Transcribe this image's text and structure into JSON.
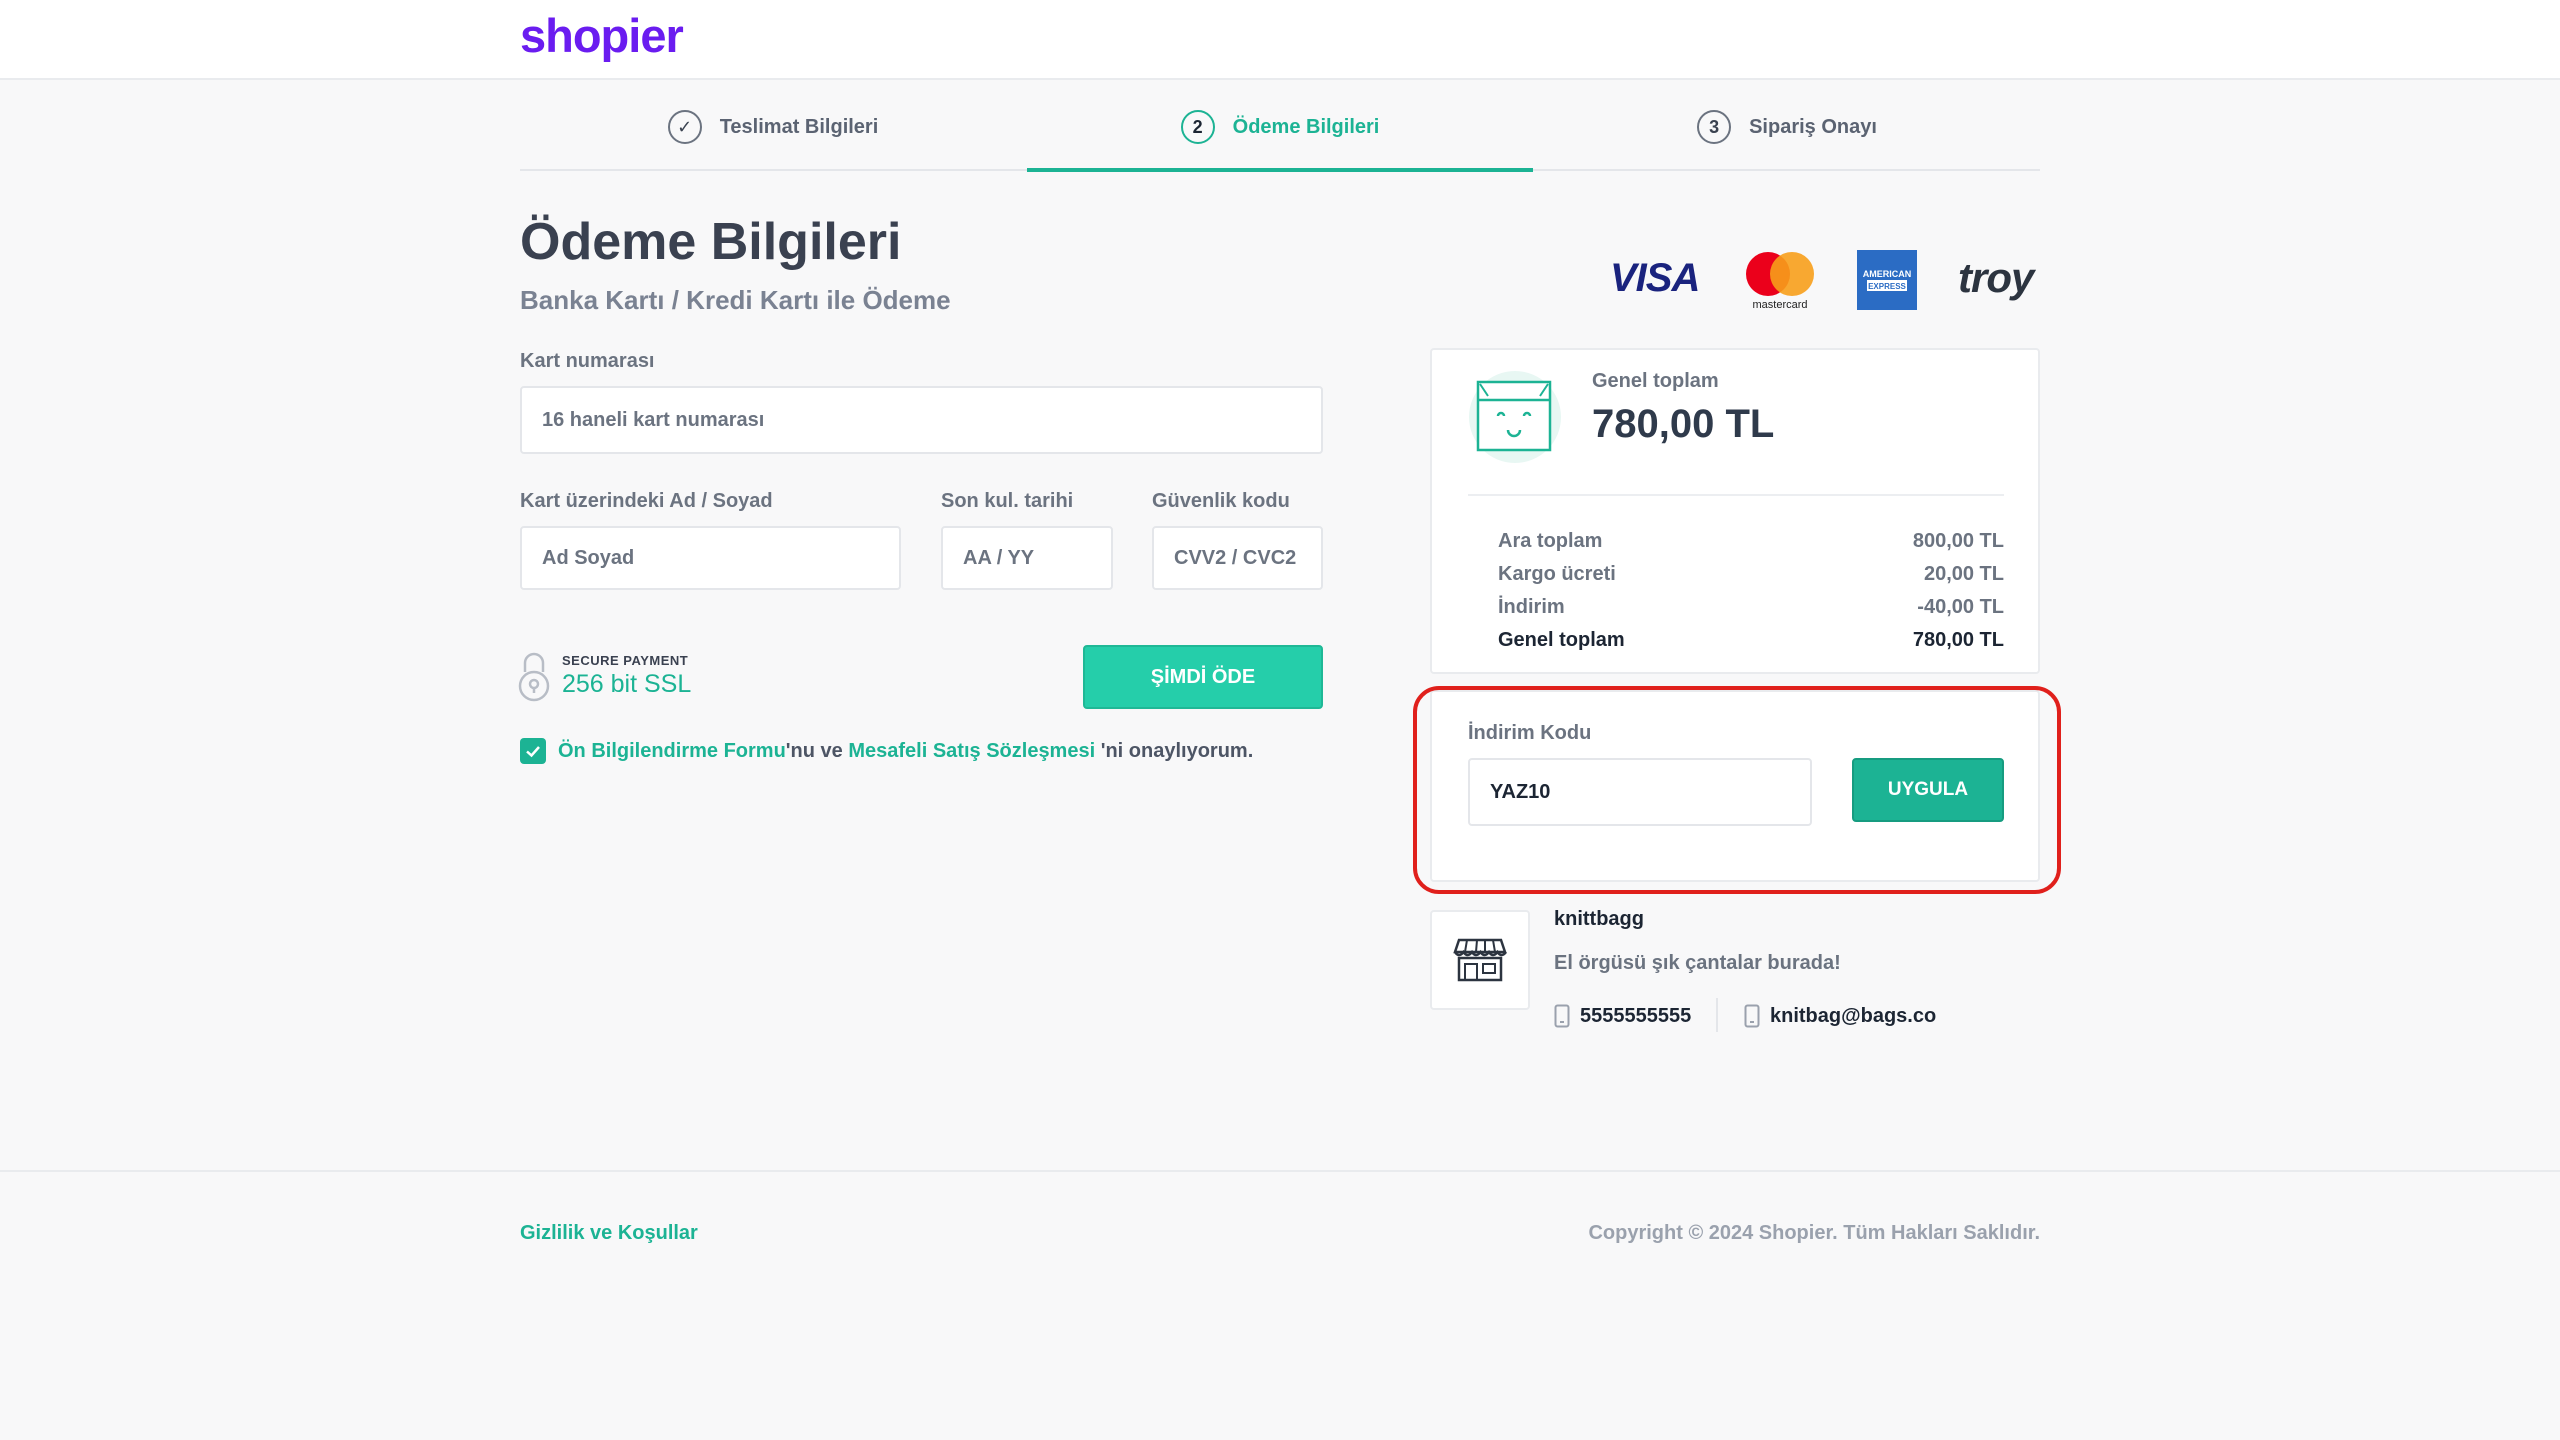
{
  "header": {
    "logo": "shopier"
  },
  "steps": [
    {
      "number": "✓",
      "label": "Teslimat Bilgileri"
    },
    {
      "number": "2",
      "label": "Ödeme Bilgileri"
    },
    {
      "number": "3",
      "label": "Sipariş Onayı"
    }
  ],
  "payment": {
    "title": "Ödeme Bilgileri",
    "subtitle": "Banka Kartı / Kredi Kartı ile Ödeme",
    "card_number_label": "Kart numarası",
    "card_number_placeholder": "16 haneli kart numarası",
    "name_label": "Kart üzerindeki Ad / Soyad",
    "name_placeholder": "Ad Soyad",
    "expiry_label": "Son kul. tarihi",
    "expiry_placeholder": "AA / YY",
    "cvv_label": "Güvenlik kodu",
    "cvv_placeholder": "CVV2 / CVC2",
    "secure_small": "SECURE PAYMENT",
    "secure_big": "256 bit SSL",
    "pay_button": "ŞİMDİ ÖDE",
    "consent_link1": "Ön Bilgilendirme Formu",
    "consent_mid": "'nu ve ",
    "consent_link2": "Mesafeli Satış Sözleşmesi",
    "consent_end": " 'ni onaylıyorum."
  },
  "card_logos": {
    "visa": "VISA",
    "mastercard": "mastercard",
    "amex_line1": "AMERICAN",
    "amex_line2": "EXPRESS",
    "troy": "troy"
  },
  "summary": {
    "grand_total_label": "Genel toplam",
    "grand_total_value": "780,00 TL",
    "rows": [
      {
        "label": "Ara toplam",
        "value": "800,00 TL"
      },
      {
        "label": "Kargo ücreti",
        "value": "20,00 TL"
      },
      {
        "label": "İndirim",
        "value": "-40,00 TL"
      },
      {
        "label": "Genel toplam",
        "value": "780,00 TL"
      }
    ]
  },
  "discount": {
    "label": "İndirim Kodu",
    "value": "YAZ10",
    "button": "UYGULA"
  },
  "seller": {
    "name": "knittbagg",
    "description": "El örgüsü şık çantalar burada!",
    "phone": "5555555555",
    "email": "knitbag@bags.co"
  },
  "footer": {
    "link": "Gizlilik ve Koşullar",
    "copyright": "Copyright © 2024 Shopier. Tüm Hakları Saklıdır."
  },
  "colors": {
    "brand": "#6a1cf0",
    "accent": "#1cb394",
    "highlight": "#e0201c"
  }
}
